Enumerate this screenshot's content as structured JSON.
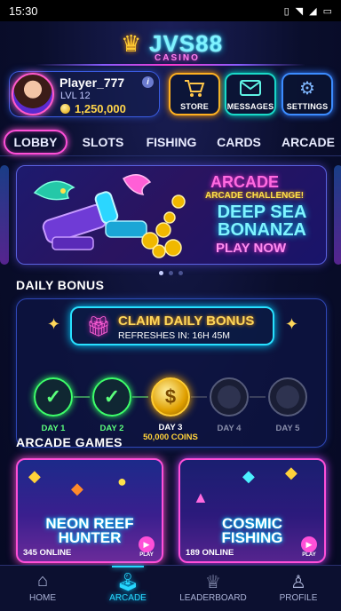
{
  "status": {
    "time": "15:30",
    "icons": [
      "vibrate-icon",
      "wifi-icon",
      "signal-icon",
      "battery-icon"
    ]
  },
  "brand": {
    "name": "JVS88",
    "tagline": "CASINO"
  },
  "profile": {
    "name": "Player_777",
    "level": "LVL 12",
    "coins": "1,250,000"
  },
  "quick_actions": {
    "store": "STORE",
    "messages": "MESSAGES",
    "settings": "SETTINGS"
  },
  "tabs": [
    "LOBBY",
    "SLOTS",
    "FISHING",
    "CARDS",
    "ARCADE"
  ],
  "active_tab": "LOBBY",
  "banner": {
    "category": "ARCADE",
    "challenge": "ARCADE CHALLENGE!",
    "title": "DEEP SEA BONANZA",
    "cta": "PLAY NOW",
    "slides": 3,
    "active_slide": 1
  },
  "daily_bonus": {
    "section_title": "DAILY BONUS",
    "claim_title": "CLAIM DAILY BONUS",
    "refresh_text": "REFRESHES IN: 16H 45M",
    "days": [
      {
        "label": "DAY 1",
        "state": "claimed"
      },
      {
        "label": "DAY 2",
        "state": "claimed"
      },
      {
        "label": "DAY 3",
        "state": "current",
        "reward": "50,000 COINS"
      },
      {
        "label": "DAY 4",
        "state": "locked"
      },
      {
        "label": "DAY 5",
        "state": "locked"
      }
    ]
  },
  "arcade": {
    "section_title": "ARCADE GAMES",
    "games": [
      {
        "title_line1": "NEON REEF",
        "title_line2": "HUNTER",
        "online": "345 ONLINE",
        "play": "PLAY"
      },
      {
        "title_line1": "COSMIC",
        "title_line2": "FISHING",
        "online": "189 ONLINE",
        "play": "PLAY"
      }
    ]
  },
  "nav": {
    "home": "HOME",
    "arcade": "ARCADE",
    "leaderboard": "LEADERBOARD",
    "profile": "PROFILE",
    "active": "ARCADE"
  },
  "colors": {
    "neon_pink": "#ff4fd8",
    "neon_cyan": "#27d8ff",
    "gold": "#ffd23a",
    "green": "#3dff6a",
    "bg": "#070b24"
  }
}
